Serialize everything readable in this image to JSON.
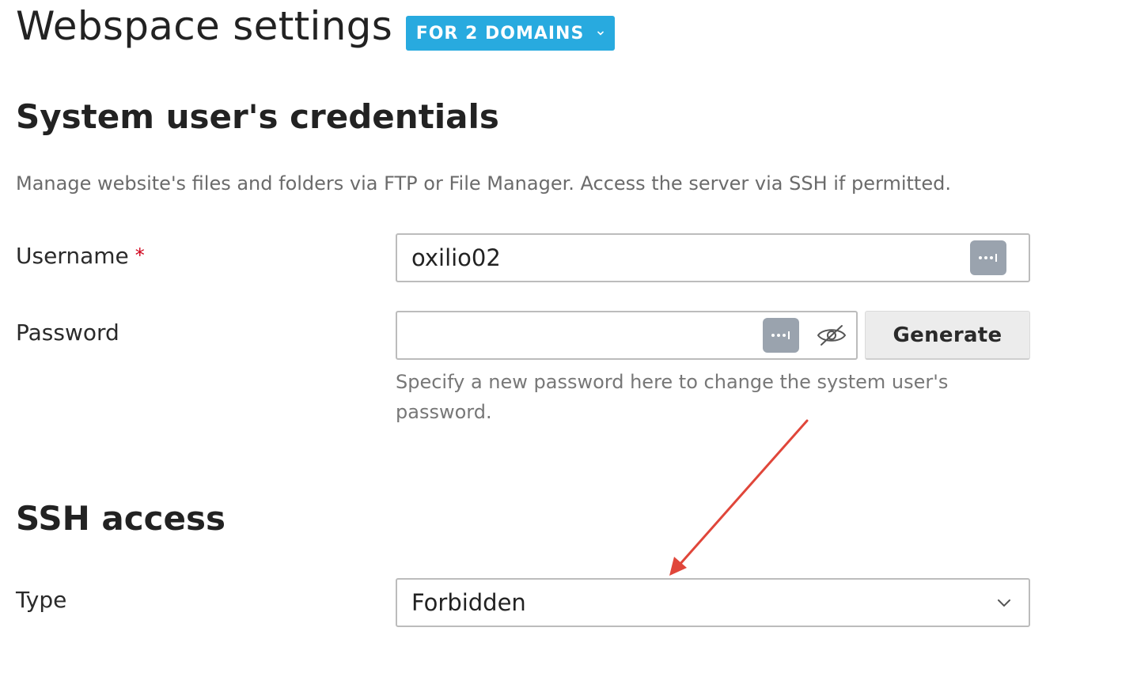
{
  "header": {
    "title": "Webspace settings",
    "domains_button_label": "FOR 2 DOMAINS"
  },
  "credentials": {
    "heading": "System user's credentials",
    "description": "Manage website's files and folders via FTP or File Manager. Access the server via SSH if permitted.",
    "username_label": "Username",
    "username_required_mark": "*",
    "username_value": "oxilio02",
    "password_label": "Password",
    "password_value": "",
    "generate_label": "Generate",
    "password_hint": "Specify a new password here to change the system user's password."
  },
  "ssh": {
    "heading": "SSH access",
    "type_label": "Type",
    "type_selected": "Forbidden"
  },
  "icons": {
    "domains_chevron": "chevron-down-icon",
    "username_key": "password-manager-icon",
    "password_key": "password-manager-icon",
    "password_visibility": "eye-slash-icon",
    "select_chevron": "chevron-down-icon"
  },
  "colors": {
    "accent": "#28aadf",
    "required": "#d0021b",
    "annotation_arrow": "#e0463a"
  }
}
